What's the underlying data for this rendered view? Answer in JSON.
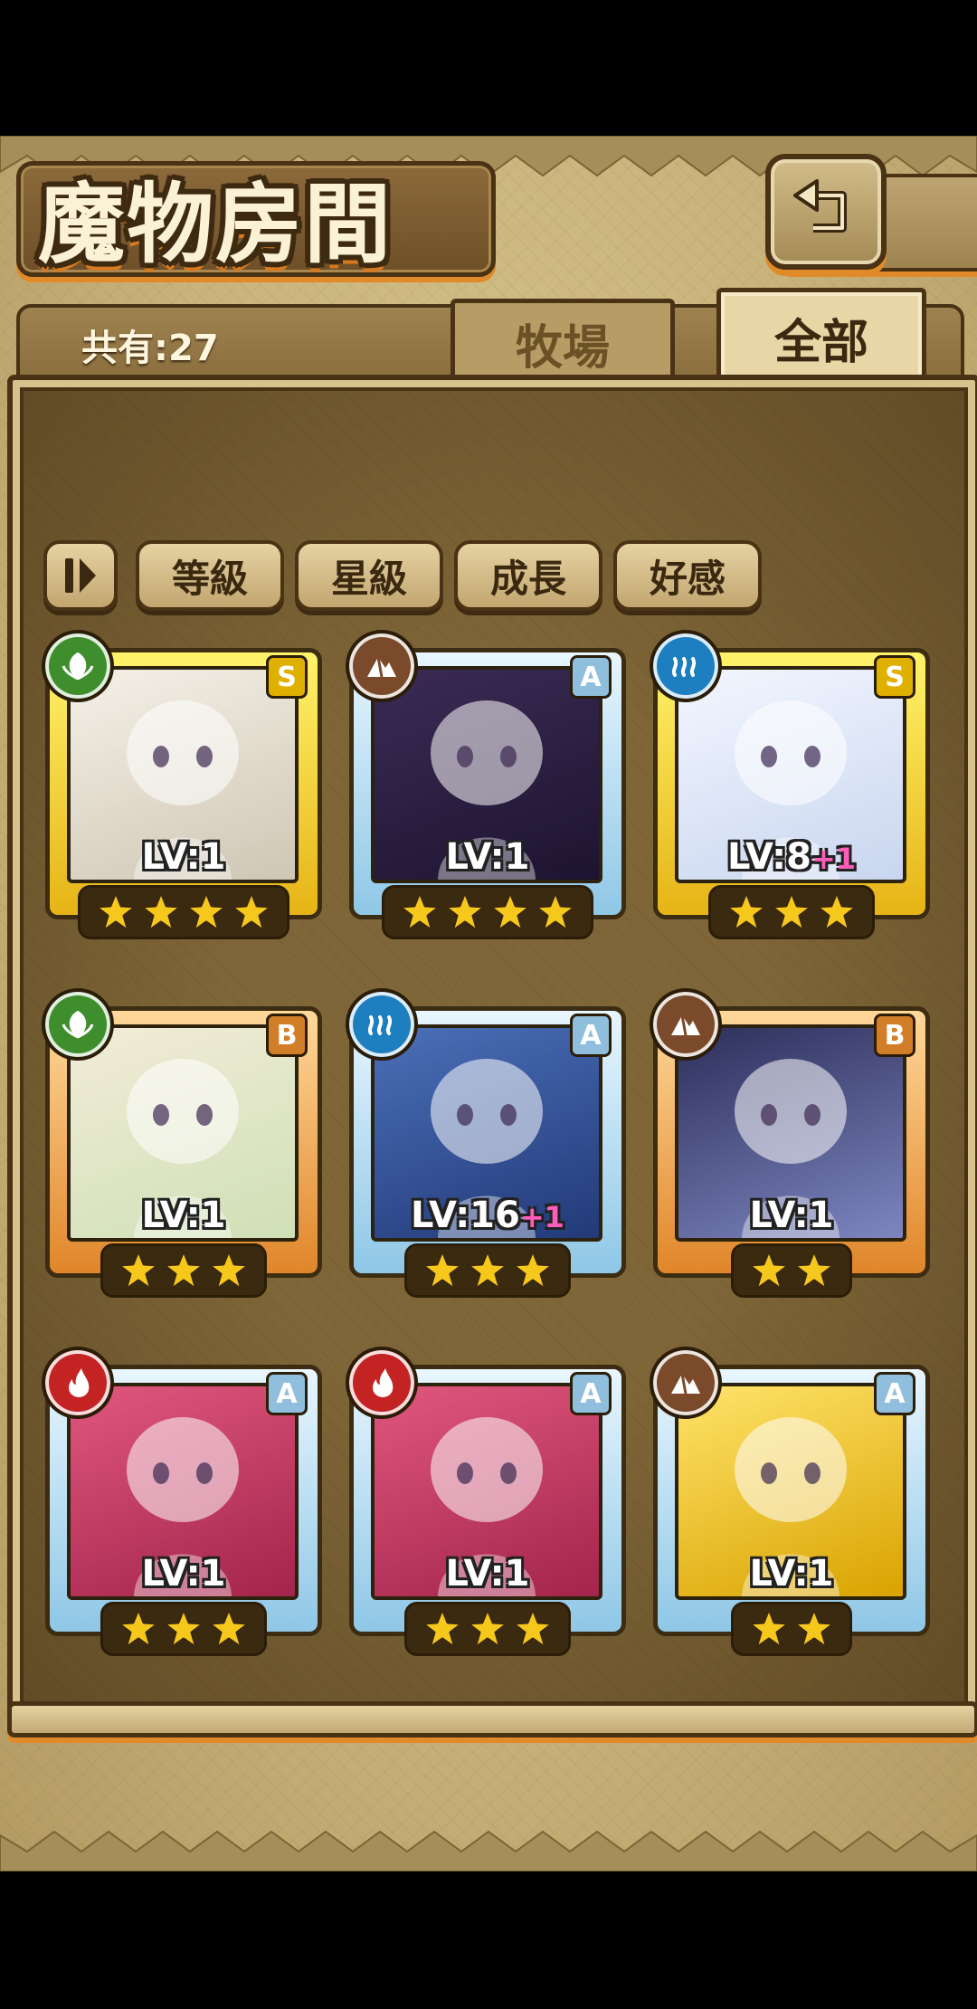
{
  "title": "魔物房間",
  "count_text": "共有:27",
  "tabs": [
    {
      "label": "牧場",
      "active": false
    },
    {
      "label": "全部",
      "active": true
    }
  ],
  "sort_buttons": [
    "等級",
    "星級",
    "成長",
    "好感"
  ],
  "cards": [
    {
      "element": "leaf",
      "rank": "S",
      "frame": "gold",
      "level": "LV:1",
      "plus": "",
      "stars": 4
    },
    {
      "element": "rock",
      "rank": "A",
      "frame": "blue",
      "level": "LV:1",
      "plus": "",
      "stars": 4
    },
    {
      "element": "water",
      "rank": "S",
      "frame": "gold",
      "level": "LV:8",
      "plus": "+1",
      "stars": 3
    },
    {
      "element": "leaf",
      "rank": "B",
      "frame": "orange",
      "level": "LV:1",
      "plus": "",
      "stars": 3
    },
    {
      "element": "water",
      "rank": "A",
      "frame": "blue",
      "level": "LV:16",
      "plus": "+1",
      "stars": 3
    },
    {
      "element": "rock",
      "rank": "B",
      "frame": "orange",
      "level": "LV:1",
      "plus": "",
      "stars": 2
    },
    {
      "element": "fire",
      "rank": "A",
      "frame": "blue",
      "level": "LV:1",
      "plus": "",
      "stars": 3
    },
    {
      "element": "fire",
      "rank": "A",
      "frame": "blue",
      "level": "LV:1",
      "plus": "",
      "stars": 3
    },
    {
      "element": "rock",
      "rank": "A",
      "frame": "blue",
      "level": "LV:1",
      "plus": "",
      "stars": 2
    }
  ],
  "colors": {
    "frame_border": "#4a3214",
    "accent_orange": "#e08a2a",
    "star": "#f7c81c"
  }
}
